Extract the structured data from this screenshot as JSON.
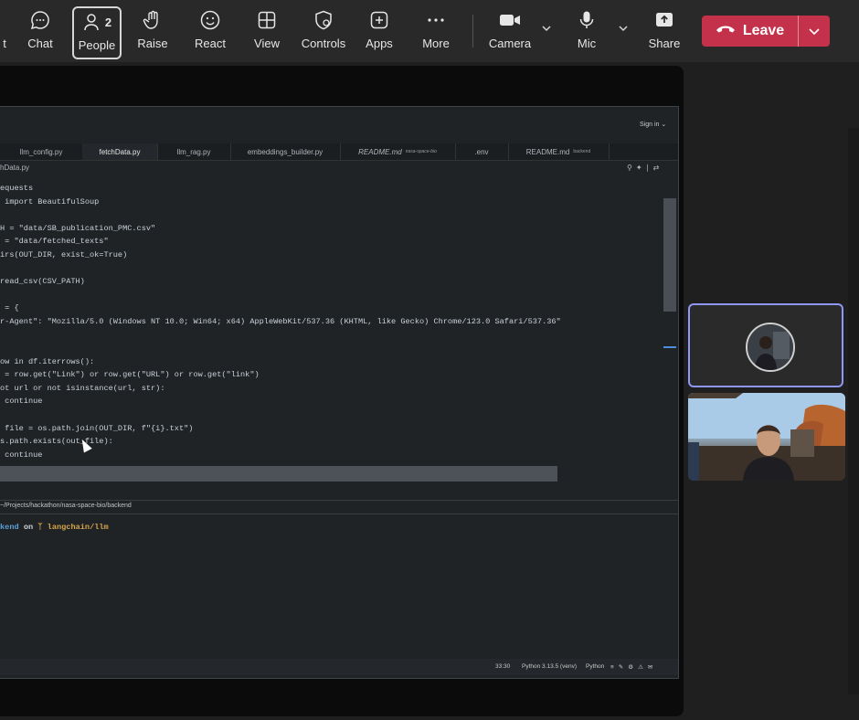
{
  "toolbar": {
    "partial_left": "t",
    "chat": "Chat",
    "people": "People",
    "people_count": "2",
    "raise": "Raise",
    "react": "React",
    "view": "View",
    "controls": "Controls",
    "apps": "Apps",
    "more": "More",
    "camera": "Camera",
    "mic": "Mic",
    "share": "Share",
    "leave": "Leave"
  },
  "editor": {
    "signin": "Sign in",
    "tabs": [
      {
        "label": "llm_config.py",
        "sub": ""
      },
      {
        "label": "fetchData.py",
        "sub": ""
      },
      {
        "label": "llm_rag.py",
        "sub": ""
      },
      {
        "label": "embeddings_builder.py",
        "sub": ""
      },
      {
        "label": "README.md",
        "sub": "nasa-space-bio"
      },
      {
        "label": ".env",
        "sub": ""
      },
      {
        "label": "README.md",
        "sub": "backend"
      }
    ],
    "breadcrumb": "hData.py",
    "code_lines": [
      "equests",
      " import BeautifulSoup",
      "",
      "H = \"data/SB_publication_PMC.csv\"",
      " = \"data/fetched_texts\"",
      "irs(OUT_DIR, exist_ok=True)",
      "",
      "read_csv(CSV_PATH)",
      "",
      " = {",
      "r-Agent\": \"Mozilla/5.0 (Windows NT 10.0; Win64; x64) AppleWebKit/537.36 (KHTML, like Gecko) Chrome/123.0 Safari/537.36\"",
      "",
      "",
      "ow in df.iterrows():",
      " = row.get(\"Link\") or row.get(\"URL\") or row.get(\"link\")",
      "ot url or not isinstance(url, str):",
      " continue",
      "",
      " file = os.path.join(OUT_DIR, f\"{i}.txt\")",
      "s.path.exists(out_file):",
      " continue"
    ],
    "terminal_path": "~/Projects/hackathon/nasa-space-bio/backend",
    "prompt_dir": "kend",
    "prompt_on": "on",
    "prompt_branch": "langchain/llm",
    "status": {
      "position": "33:30",
      "interpreter": "Python 3.13.5 (venv)",
      "language": "Python"
    }
  },
  "colors": {
    "leave_bg": "#c4314b",
    "active_tile_border": "#8f96f5",
    "toolbar_bg": "#292929"
  }
}
